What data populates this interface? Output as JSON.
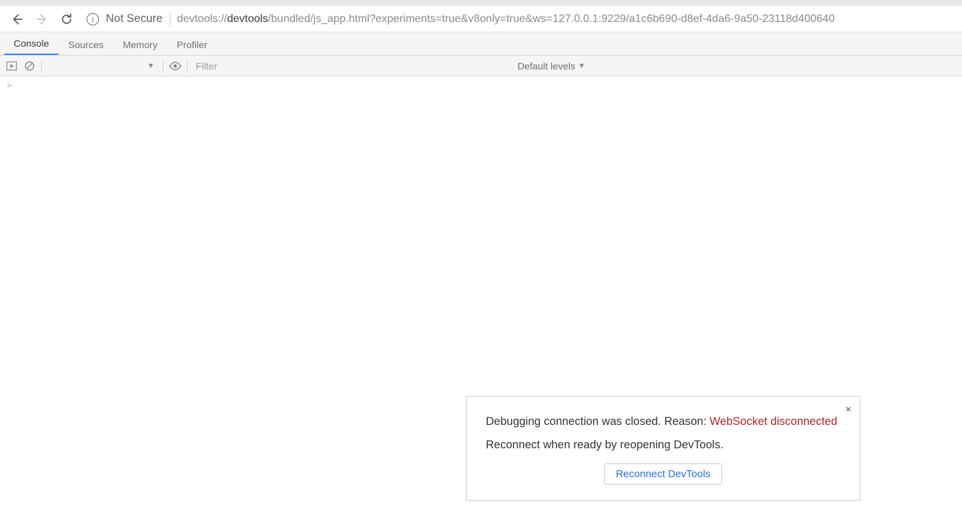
{
  "browser": {
    "security_label": "Not Secure",
    "url_prefix": "devtools://",
    "url_bold": "devtools",
    "url_rest": "/bundled/js_app.html?experiments=true&v8only=true&ws=127.0.0.1:9229/a1c6b690-d8ef-4da6-9a50-23118d400640"
  },
  "tabs": {
    "items": [
      {
        "label": "Console",
        "active": true
      },
      {
        "label": "Sources",
        "active": false
      },
      {
        "label": "Memory",
        "active": false
      },
      {
        "label": "Profiler",
        "active": false
      }
    ]
  },
  "console_toolbar": {
    "filter_placeholder": "Filter",
    "levels_label": "Default levels"
  },
  "dialog": {
    "line1_prefix": "Debugging connection was closed. Reason: ",
    "line1_error": "WebSocket disconnected",
    "line2": "Reconnect when ready by reopening DevTools.",
    "button_label": "Reconnect DevTools",
    "close_glyph": "×"
  },
  "icons": {
    "prompt_caret": ">",
    "dropdown_caret": "▼"
  }
}
